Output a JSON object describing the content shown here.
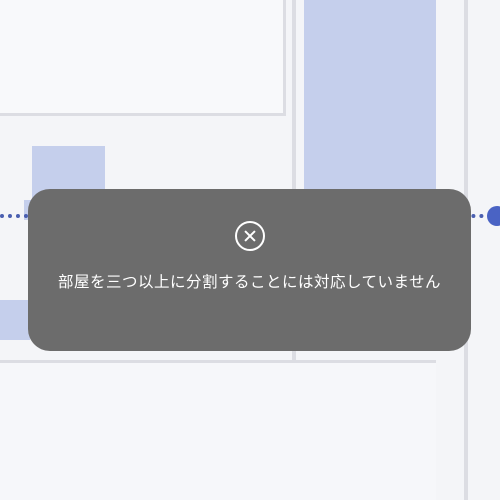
{
  "floor_plan": {
    "split_line_color": "#4a5fb0",
    "room_fill_color": "#c5cfec",
    "wall_color": "#dcdde3"
  },
  "toast": {
    "icon": "close-circle-icon",
    "message": "部屋を三つ以上に分割することには対応していません",
    "background_color": "#6c6c6c",
    "text_color": "#ffffff"
  }
}
